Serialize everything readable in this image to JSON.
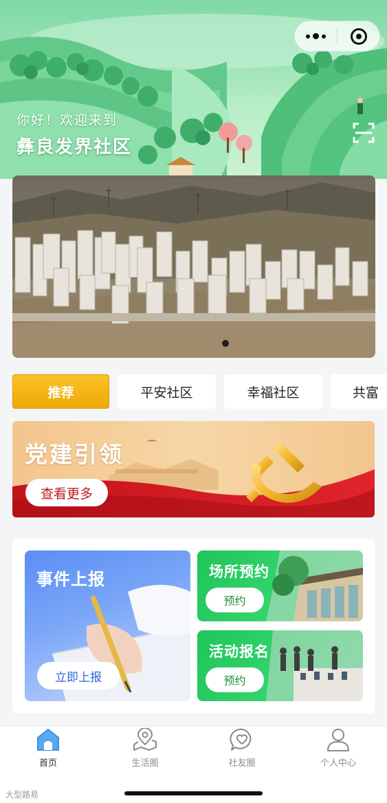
{
  "header": {
    "greeting": "你好！欢迎来到",
    "community_name": "彝良发界社区",
    "capsule": {
      "more_icon": "more-dots-icon",
      "close_icon": "target-close-icon"
    },
    "scan_icon": "scan-icon"
  },
  "banner": {
    "slide_count": 1,
    "active_slide": 1
  },
  "tabs": [
    {
      "label": "推荐",
      "active": true
    },
    {
      "label": "平安社区",
      "active": false
    },
    {
      "label": "幸福社区",
      "active": false
    },
    {
      "label": "共富",
      "active": false
    }
  ],
  "party_card": {
    "title": "党建引领",
    "button_label": "查看更多"
  },
  "services": {
    "report": {
      "title": "事件上报",
      "button_label": "立即上报"
    },
    "venue": {
      "title": "场所预约",
      "button_label": "预约"
    },
    "activity": {
      "title": "活动报名",
      "button_label": "预约"
    }
  },
  "bottom_nav": [
    {
      "label": "首页",
      "icon": "home-icon",
      "active": true
    },
    {
      "label": "生活圈",
      "icon": "map-pin-icon",
      "active": false
    },
    {
      "label": "社友圈",
      "icon": "heart-chat-icon",
      "active": false
    },
    {
      "label": "个人中心",
      "icon": "user-icon",
      "active": false
    }
  ],
  "watermark": "大型路易",
  "colors": {
    "tab_active": "#f5b418",
    "party_red": "#c0171e",
    "report_blue": "#5b8ef5",
    "service_green": "#2fcf66",
    "hero_green": "#7fd8a6"
  }
}
